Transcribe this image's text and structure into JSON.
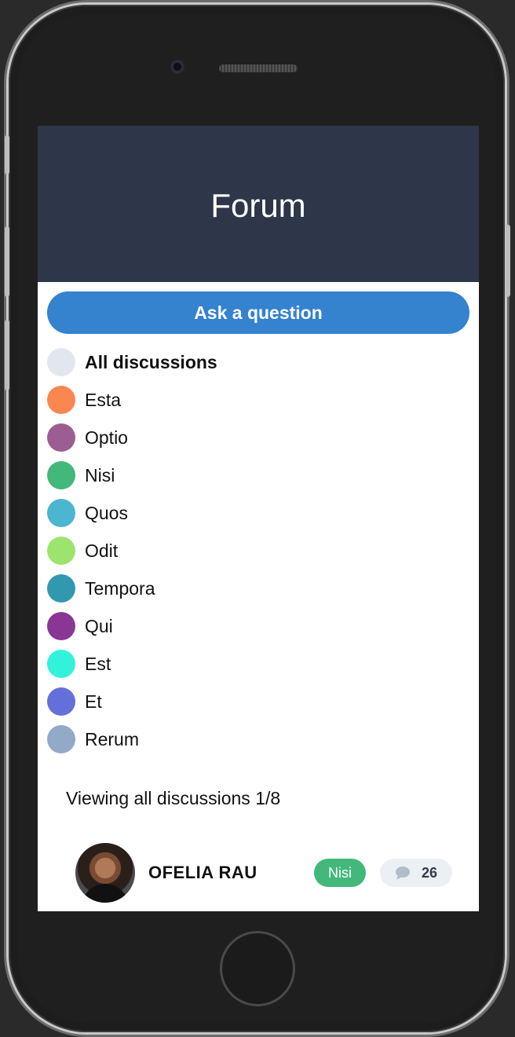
{
  "header": {
    "title": "Forum"
  },
  "actions": {
    "ask_label": "Ask a question"
  },
  "tags": [
    {
      "label": "All discussions",
      "color": "#e2e7ef",
      "bold": true
    },
    {
      "label": "Esta",
      "color": "#fa8650"
    },
    {
      "label": "Optio",
      "color": "#9c5e92"
    },
    {
      "label": "Nisi",
      "color": "#42b87a"
    },
    {
      "label": "Quos",
      "color": "#4bb6d0"
    },
    {
      "label": "Odit",
      "color": "#9ce46e"
    },
    {
      "label": "Tempora",
      "color": "#3298b0"
    },
    {
      "label": "Qui",
      "color": "#8a3694"
    },
    {
      "label": "Est",
      "color": "#33f2dc"
    },
    {
      "label": "Et",
      "color": "#6470da"
    },
    {
      "label": "Rerum",
      "color": "#92a9c8"
    }
  ],
  "listing": {
    "status": "Viewing all discussions 1/8"
  },
  "discussions": [
    {
      "author": "OFELIA RAU",
      "tag": "Nisi",
      "tag_color": "#42b87a",
      "replies": "26",
      "reply_icon": "chat-bubble-icon"
    }
  ]
}
